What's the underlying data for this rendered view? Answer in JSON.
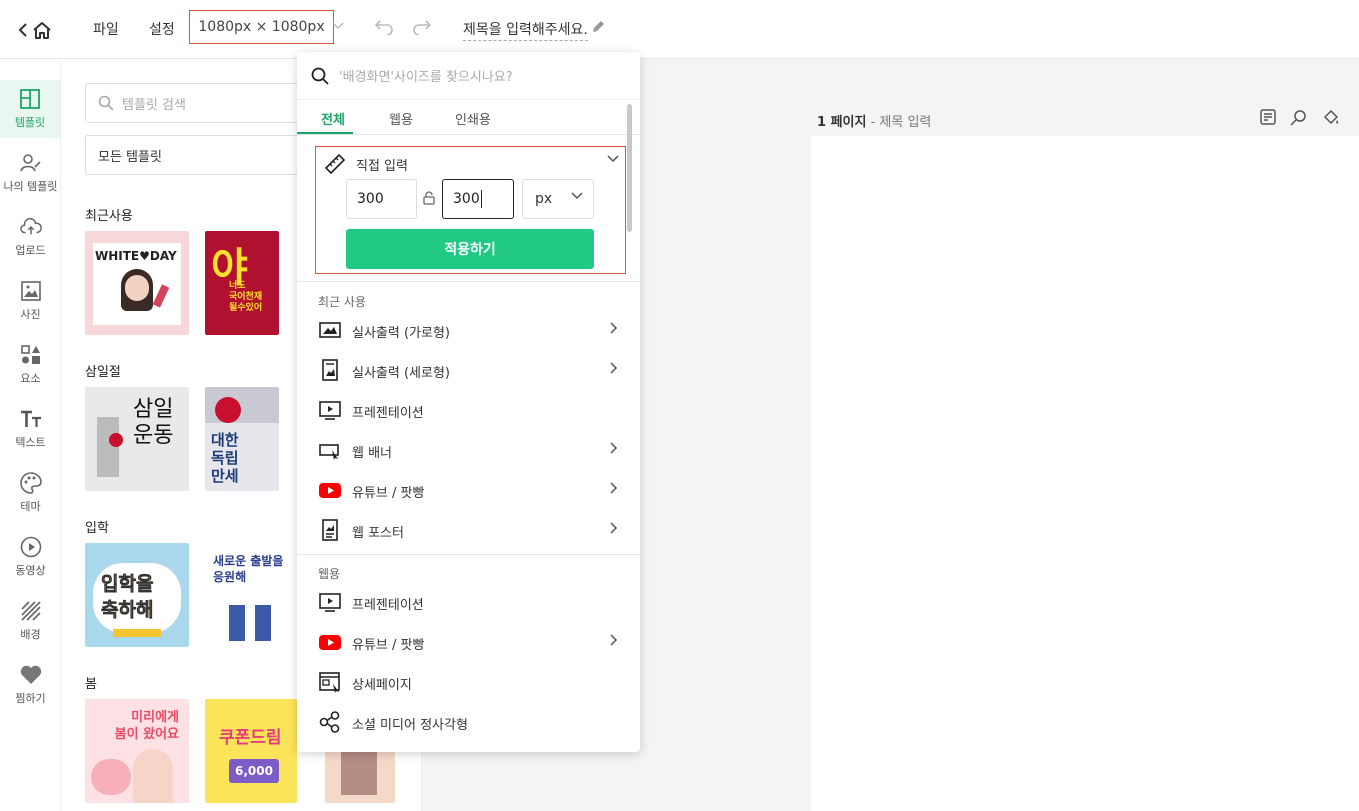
{
  "topbar": {
    "menu_file": "파일",
    "menu_settings": "설정",
    "size": "1080px × 1080px",
    "title": "제목을 입력해주세요."
  },
  "rail": [
    {
      "label": "템플릿",
      "icon": "template-icon"
    },
    {
      "label": "나의 템플릿",
      "icon": "my-template-icon"
    },
    {
      "label": "업로드",
      "icon": "upload-icon"
    },
    {
      "label": "사진",
      "icon": "photo-icon"
    },
    {
      "label": "요소",
      "icon": "elements-icon"
    },
    {
      "label": "텍스트",
      "icon": "text-icon"
    },
    {
      "label": "테마",
      "icon": "palette-icon"
    },
    {
      "label": "동영상",
      "icon": "video-icon"
    },
    {
      "label": "배경",
      "icon": "background-icon"
    },
    {
      "label": "찜하기",
      "icon": "heart-icon"
    }
  ],
  "panel": {
    "search_placeholder": "템플릿 검색",
    "filter": "모든 템플릿",
    "sections": [
      "최근사용",
      "삼일절",
      "입학",
      "봄"
    ],
    "thumb_texts": {
      "whiteday": "WHITE♥DAY",
      "ya": "야",
      "ya_sub": "너도\n국어천재\n될수있어",
      "samil": "삼일운동",
      "daehan": "대한\n독립\n만세",
      "ipak": "입학을\n축하해",
      "saeroun": "새로운 출발을\n응원해",
      "bom": "미리에게\n봄이 왔어요",
      "coupon": "쿠폰드림",
      "coupon_price": "6,000"
    }
  },
  "canvas": {
    "page_label": "1 페이지",
    "page_sub": "- 제목 입력"
  },
  "dropdown": {
    "search_placeholder": "'배경화면'사이즈를 찾으시나요?",
    "tabs": [
      "전체",
      "웹용",
      "인쇄용"
    ],
    "direct_label": "직접 입력",
    "width": "300",
    "height": "300",
    "unit": "px",
    "apply": "적용하기",
    "recent_label": "최근 사용",
    "recent": [
      {
        "label": "실사출력 (가로형)",
        "icon": "landscape-print-icon",
        "arrow": true
      },
      {
        "label": "실사출력 (세로형)",
        "icon": "portrait-print-icon",
        "arrow": true
      },
      {
        "label": "프레젠테이션",
        "icon": "presentation-icon",
        "arrow": false
      },
      {
        "label": "웹 배너",
        "icon": "web-banner-icon",
        "arrow": true
      },
      {
        "label": "유튜브 / 팟빵",
        "icon": "youtube-icon",
        "arrow": true
      },
      {
        "label": "웹 포스터",
        "icon": "web-poster-icon",
        "arrow": true
      }
    ],
    "web_label": "웹용",
    "web": [
      {
        "label": "프레젠테이션",
        "icon": "presentation-icon",
        "arrow": false
      },
      {
        "label": "유튜브 / 팟빵",
        "icon": "youtube-icon",
        "arrow": true
      },
      {
        "label": "상세페이지",
        "icon": "detail-page-icon",
        "arrow": false
      },
      {
        "label": "소셜 미디어 정사각형",
        "icon": "share-icon",
        "arrow": false
      }
    ]
  },
  "colors": {
    "accent": "#22c985",
    "highlight_border": "#d9583b",
    "youtube": "#ff0000"
  }
}
